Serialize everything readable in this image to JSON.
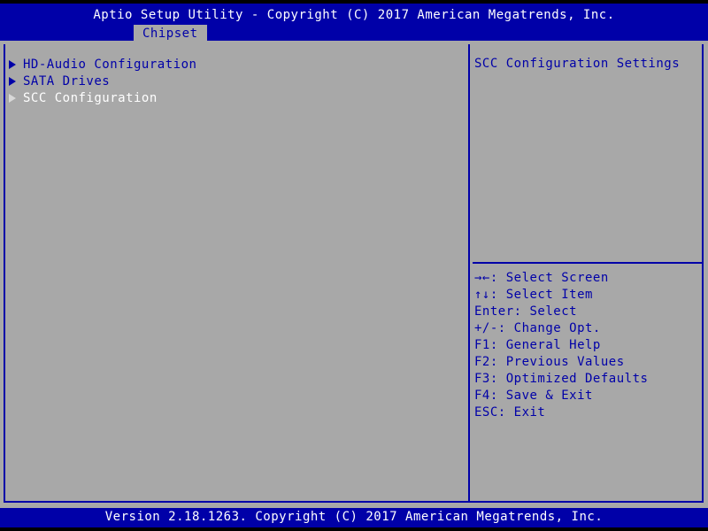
{
  "header": {
    "title": "Aptio Setup Utility - Copyright (C) 2017 American Megatrends, Inc.",
    "tabs": [
      {
        "label": "Chipset",
        "selected": true
      }
    ]
  },
  "menu": {
    "items": [
      {
        "label": "HD-Audio Configuration",
        "marker": "submenu-triangle-icon",
        "selected": false
      },
      {
        "label": "SATA Drives",
        "marker": "submenu-triangle-icon",
        "selected": false
      },
      {
        "label": "SCC Configuration",
        "marker": "submenu-triangle-icon",
        "selected": true
      }
    ]
  },
  "help": {
    "description": "SCC Configuration Settings",
    "keys": [
      {
        "key": "→←",
        "text": ": Select Screen"
      },
      {
        "key": "↑↓",
        "text": ": Select Item"
      },
      {
        "key": "Enter",
        "text": ": Select"
      },
      {
        "key": "+/-",
        "text": ": Change Opt."
      },
      {
        "key": "F1",
        "text": ": General Help"
      },
      {
        "key": "F2",
        "text": ": Previous Values"
      },
      {
        "key": "F3",
        "text": ": Optimized Defaults"
      },
      {
        "key": "F4",
        "text": ": Save & Exit"
      },
      {
        "key": "ESC",
        "text": ": Exit"
      }
    ],
    "key_lines": [
      "→←: Select Screen",
      "↑↓: Select Item",
      "Enter: Select",
      "+/-: Change Opt.",
      "F1: General Help",
      "F2: Previous Values",
      "F3: Optimized Defaults",
      "F4: Save & Exit",
      "ESC: Exit"
    ]
  },
  "footer": {
    "version_text": "Version 2.18.1263. Copyright (C) 2017 American Megatrends, Inc."
  },
  "colors": {
    "bios_blue": "#0000a8",
    "panel_gray": "#a8a8a8",
    "text_white": "#ffffff",
    "screen_black": "#000000"
  }
}
